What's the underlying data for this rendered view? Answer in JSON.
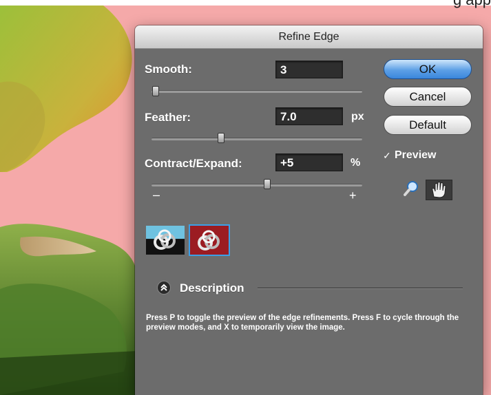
{
  "dialog": {
    "title": "Refine Edge",
    "smooth": {
      "label": "Smooth:",
      "value": "3",
      "slider_fraction": 0.02
    },
    "feather": {
      "label": "Feather:",
      "value": "7.0",
      "unit": "px",
      "slider_fraction": 0.33
    },
    "contract_expand": {
      "label": "Contract/Expand:",
      "value": "+5",
      "unit": "%",
      "slider_fraction": 0.55,
      "min_symbol": "–",
      "max_symbol": "+"
    },
    "buttons": {
      "ok": "OK",
      "cancel": "Cancel",
      "default": "Default"
    },
    "preview": {
      "label": "Preview",
      "checked": true
    },
    "description": {
      "heading": "Description",
      "text": "Press P to toggle the preview of the edge refinements. Press F to cycle through the preview modes, and X to temporarily view the image."
    }
  },
  "background": {
    "top_right_text": "g  app"
  },
  "colors": {
    "dialog_bg": "#6c6c6c",
    "ok_blue": "#4b93e1",
    "selection_blue": "#3aa0e8",
    "backdrop_pink": "#f5a8a8",
    "leaf_green": "#7aa236"
  },
  "icons": [
    "zoom-tool-icon",
    "hand-tool-icon",
    "view-mode-on-black-icon",
    "view-mode-on-red-icon",
    "disclosure-chevron-up-icon",
    "checkmark-icon"
  ]
}
